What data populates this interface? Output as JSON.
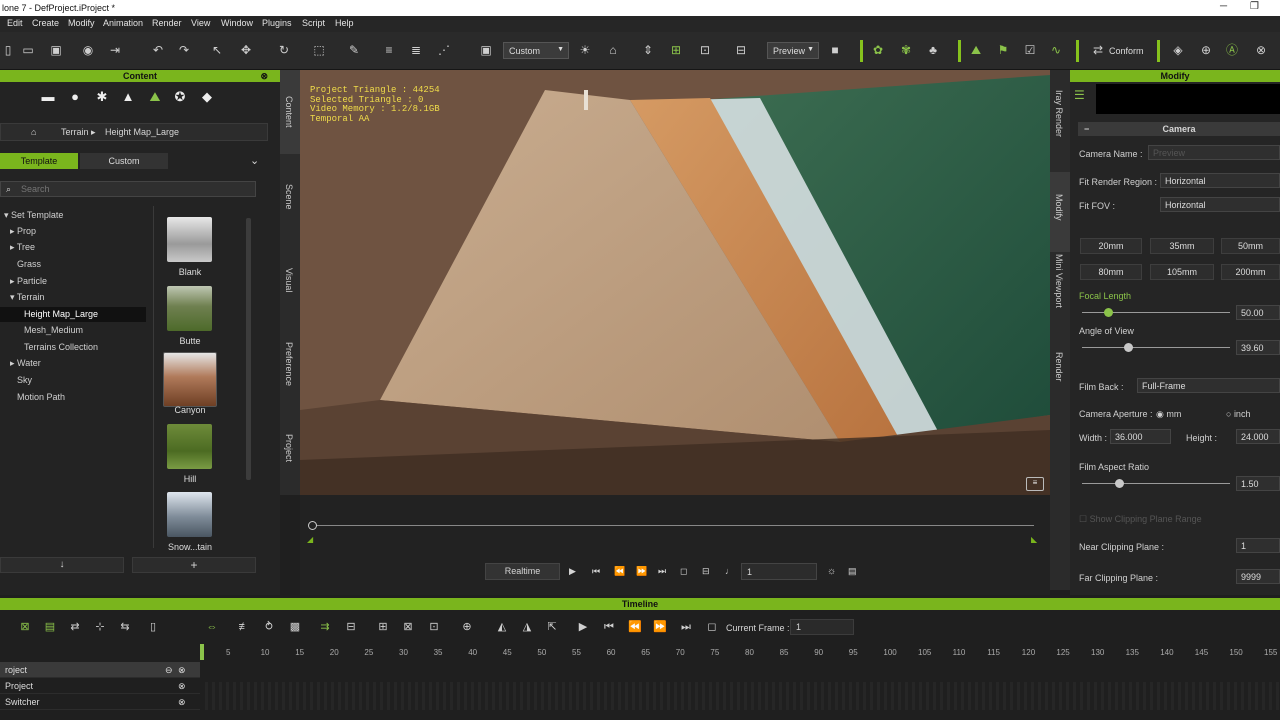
{
  "window": {
    "title": "lone 7 - DefProject.iProject *",
    "min": "─",
    "max": "❐"
  },
  "menu": [
    "Edit",
    "Create",
    "Modify",
    "Animation",
    "Render",
    "View",
    "Window",
    "Plugins",
    "Script",
    "Help"
  ],
  "toolbar": {
    "view_select": "Custom",
    "render_select": "Preview",
    "conform_label": "Conform"
  },
  "content": {
    "header": "Content",
    "breadcrumb": [
      "Terrain",
      "Height Map_Large"
    ],
    "tabs": [
      "Template",
      "Custom"
    ],
    "search_placeholder": "Search",
    "tree": [
      "Set Template",
      "Prop",
      "Tree",
      "Grass",
      "Particle",
      "Terrain",
      "Height Map_Large",
      "Mesh_Medium",
      "Terrains Collection",
      "Water",
      "Sky",
      "Motion Path"
    ],
    "items": [
      "Blank",
      "Butte",
      "Canyon",
      "Hill",
      "Snow...tain"
    ]
  },
  "side_tabs": [
    "Content",
    "Scene",
    "Visual",
    "Preference",
    "Project"
  ],
  "right_side_tabs": [
    "Iray Render",
    "Modify",
    "Mini Viewport",
    "Render"
  ],
  "hud": [
    "Project Triangle : 44254",
    "Selected Triangle : 0",
    "Video Memory : 1.2/8.1GB",
    "Temporal AA"
  ],
  "modify": {
    "header": "Modify",
    "section": "Camera",
    "camera_name_label": "Camera Name :",
    "camera_name_placeholder": "Preview",
    "fit_region_label": "Fit Render Region :",
    "fit_region_value": "Horizontal",
    "fit_fov_label": "Fit FOV :",
    "fit_fov_value": "Horizontal",
    "lenses": [
      "20mm",
      "35mm",
      "50mm",
      "80mm",
      "105mm",
      "200mm"
    ],
    "focal_label": "Focal Length",
    "focal_value": "50.00",
    "angle_label": "Angle of View",
    "angle_value": "39.60",
    "film_back_label": "Film Back :",
    "film_back_value": "Full-Frame",
    "aperture_label": "Camera Aperture :",
    "unit_mm": "mm",
    "unit_inch": "inch",
    "width_label": "Width :",
    "width_value": "36.000",
    "height_label": "Height :",
    "height_value": "24.000",
    "aspect_label": "Film Aspect Ratio",
    "aspect_value": "1.50",
    "clip_range_label": "Show Clipping Plane Range",
    "near_label": "Near Clipping Plane :",
    "near_value": "1",
    "far_label": "Far Clipping Plane :",
    "far_value": "9999"
  },
  "playbar": {
    "realtime": "Realtime",
    "frame": "1"
  },
  "timeline": {
    "header": "Timeline",
    "current_frame_label": "Current Frame :",
    "current_frame": "1",
    "ruler": [
      "5",
      "10",
      "15",
      "20",
      "25",
      "30",
      "35",
      "40",
      "45",
      "50",
      "55",
      "60",
      "65",
      "70",
      "75",
      "80",
      "85",
      "90",
      "95",
      "100",
      "105",
      "110",
      "115",
      "120",
      "125",
      "130",
      "135",
      "140",
      "145",
      "150",
      "155"
    ],
    "tracks": [
      "roject",
      "Project",
      "Switcher"
    ]
  }
}
